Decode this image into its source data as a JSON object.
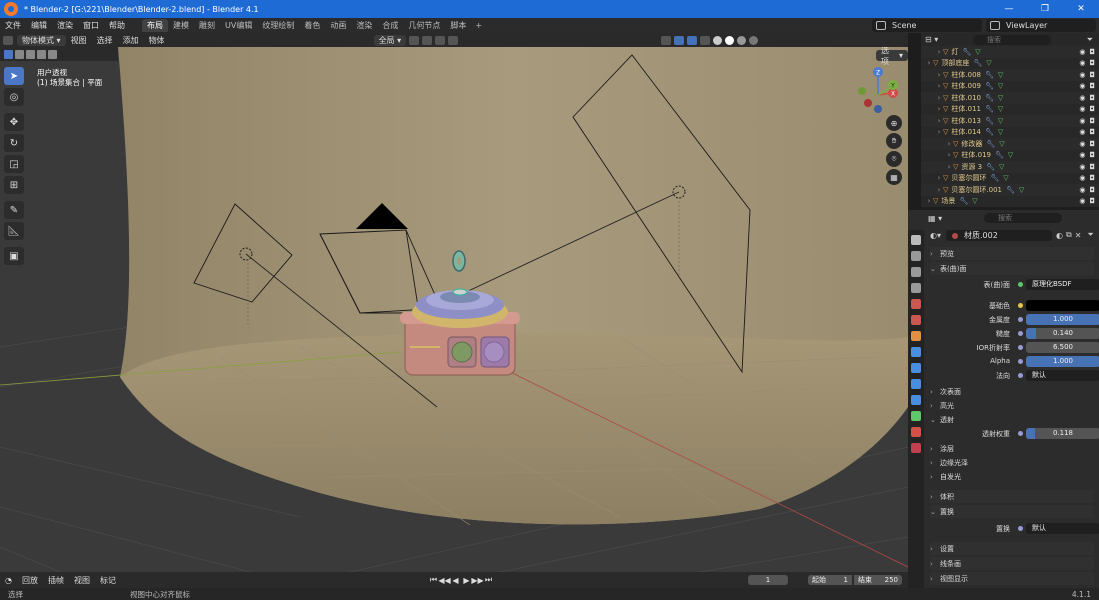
{
  "window": {
    "title": "* Blender-2 [G:\\221\\Blender\\Blender-2.blend] - Blender 4.1",
    "controls": [
      "—",
      "❐",
      "✕"
    ]
  },
  "menubar": {
    "menus": [
      "文件",
      "编辑",
      "渲染",
      "窗口",
      "帮助"
    ],
    "tabs": [
      "布局",
      "建模",
      "雕刻",
      "UV编辑",
      "纹理绘制",
      "着色",
      "动画",
      "渲染",
      "合成",
      "几何节点",
      "脚本"
    ],
    "active_tab": "布局",
    "scene": "Scene",
    "view_layer": "ViewLayer"
  },
  "viewport_header": {
    "mode": "物体模式",
    "menus": [
      "视图",
      "选择",
      "添加",
      "物体"
    ],
    "transform": "全局",
    "options": "选项"
  },
  "viewport": {
    "view_name": "用户透视",
    "collection_info": "(1) 场景集合 | 平面"
  },
  "timeline": {
    "menus": [
      "回放",
      "插帧",
      "视图",
      "标记"
    ],
    "current_frame": "1",
    "start_label": "起始",
    "start": "1",
    "end_label": "结束",
    "end": "250"
  },
  "statusbar": {
    "left": "选择",
    "mid": "视图中心对齐鼠标",
    "version": "4.1.1"
  },
  "outliner": {
    "search_placeholder": "搜索",
    "rows": [
      {
        "label": "灯",
        "indent": 1
      },
      {
        "label": "顶部底座",
        "indent": 0
      },
      {
        "label": "柱体.008",
        "indent": 1
      },
      {
        "label": "柱体.009",
        "indent": 1
      },
      {
        "label": "柱体.010",
        "indent": 1
      },
      {
        "label": "柱体.011",
        "indent": 1
      },
      {
        "label": "柱体.013",
        "indent": 1
      },
      {
        "label": "柱体.014",
        "indent": 1
      },
      {
        "label": "修改器",
        "indent": 2
      },
      {
        "label": "柱体.019",
        "indent": 2
      },
      {
        "label": "资源 3",
        "indent": 2
      },
      {
        "label": "贝塞尔圆环",
        "indent": 1
      },
      {
        "label": "贝塞尔圆环.001",
        "indent": 1
      },
      {
        "label": "场景",
        "indent": 0
      }
    ]
  },
  "properties": {
    "search_placeholder": "搜索",
    "material_name": "材质.002",
    "sections": {
      "preview": "预览",
      "surface": "表(曲)面",
      "subsurface": "次表面",
      "specular": "高光",
      "transmission": "透射",
      "coat": "涂层",
      "sheen": "边缘光泽",
      "emission": "自发光",
      "volume": "体积",
      "displacement": "置换",
      "settings": "设置",
      "line_art": "线条画",
      "viewport_display": "视图显示"
    },
    "surface_label": "表(曲)面",
    "surface_value": "原理化BSDF",
    "fields": {
      "base_color_label": "基础色",
      "metallic_label": "金属度",
      "metallic": "1.000",
      "roughness_label": "糙度",
      "roughness": "0.140",
      "ior_label": "IOR折射率",
      "ior": "6.500",
      "alpha_label": "Alpha",
      "alpha": "1.000",
      "normal_label": "法向",
      "normal": "默认",
      "trans_weight_label": "透射权重",
      "trans_weight": "0.118",
      "displacement_label": "置换",
      "displacement": "默认"
    },
    "fills": {
      "metallic": 1.0,
      "roughness": 0.14,
      "alpha": 1.0,
      "trans_weight": 0.118
    }
  },
  "colors": {
    "accent": "#4772b3",
    "titlebar": "#1e6bd6",
    "wall": "#a39373"
  }
}
